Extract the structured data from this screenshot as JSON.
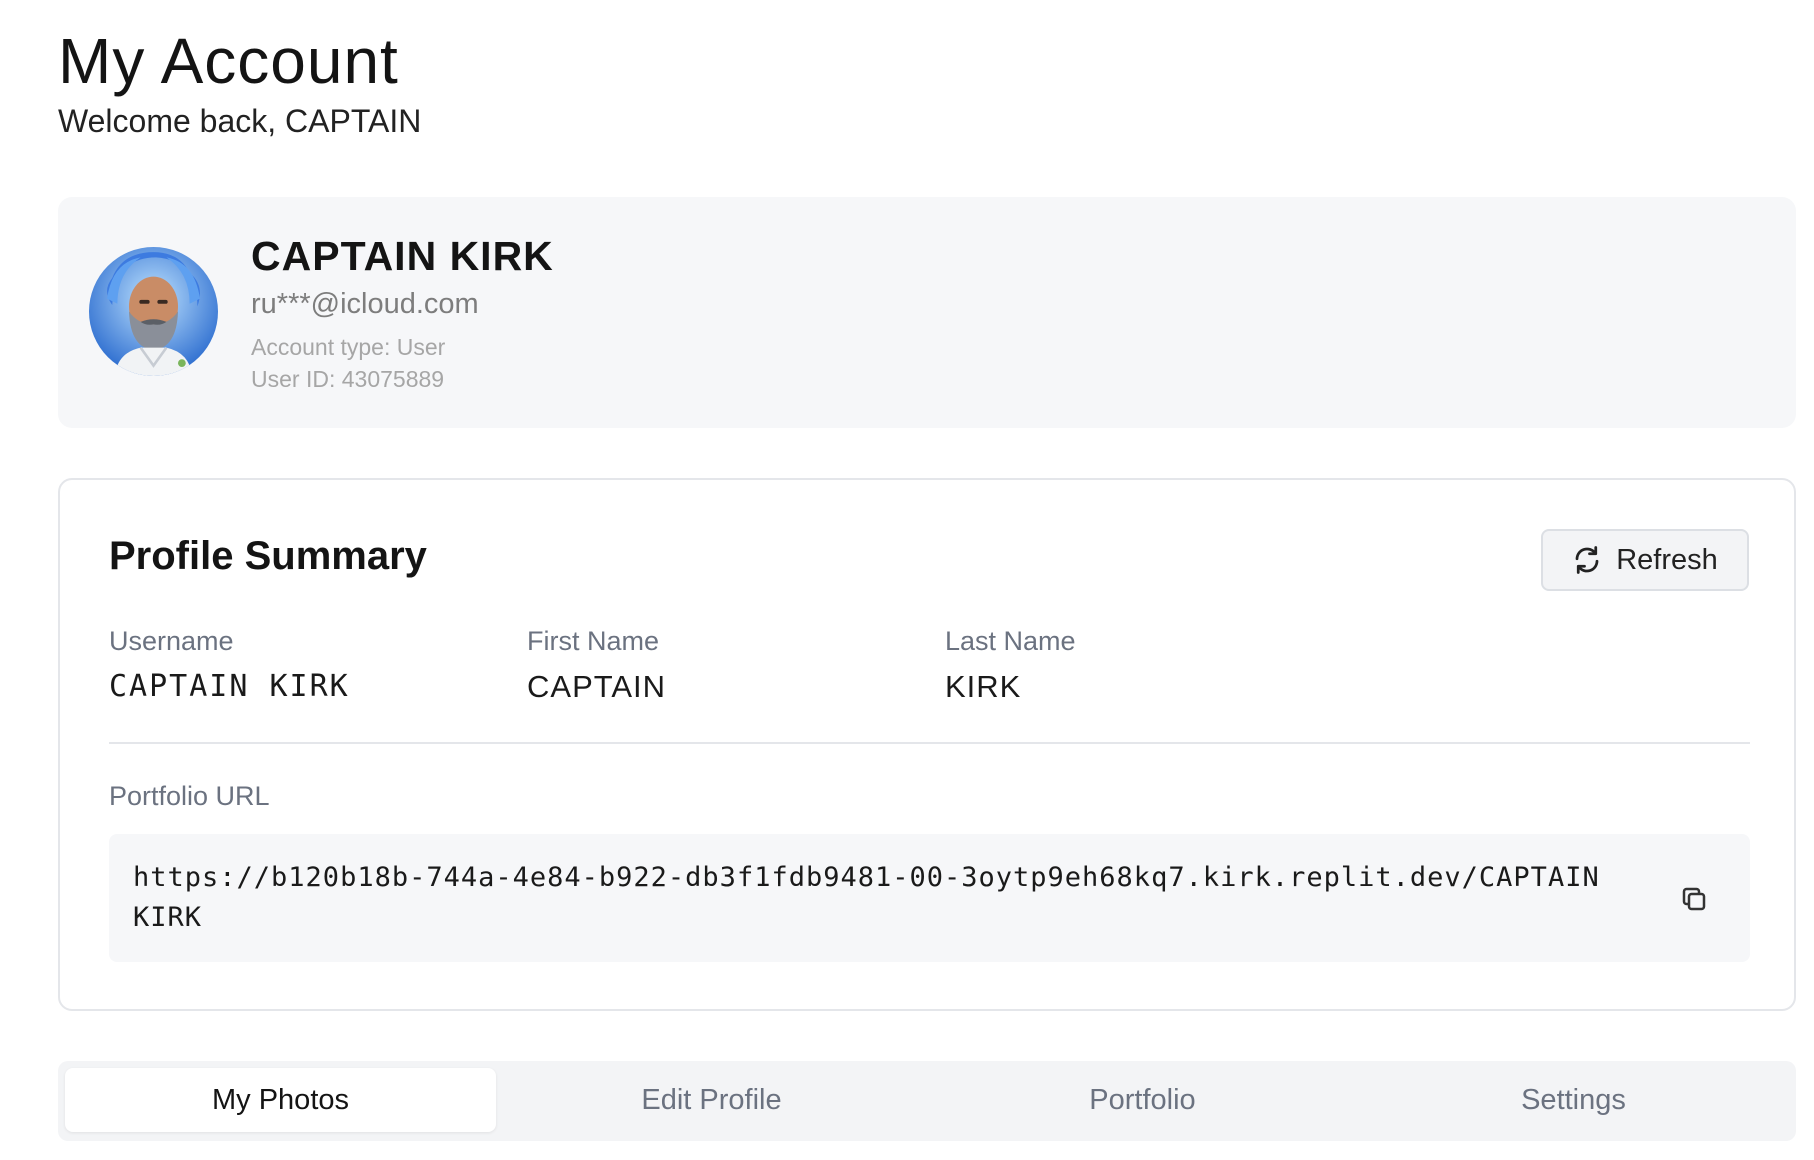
{
  "page": {
    "title": "My Account",
    "subtitle": "Welcome back, CAPTAIN"
  },
  "profile": {
    "name": "CAPTAIN KIRK",
    "email": "ru***@icloud.com",
    "account_type": "Account type: User",
    "user_id": "User ID: 43075889"
  },
  "summary": {
    "title": "Profile Summary",
    "refresh_label": "Refresh",
    "fields": [
      {
        "label": "Username",
        "value": "CAPTAIN KIRK"
      },
      {
        "label": "First Name",
        "value": "CAPTAIN"
      },
      {
        "label": "Last Name",
        "value": "KIRK"
      }
    ],
    "portfolio_label": "Portfolio URL",
    "portfolio_url": "https://b120b18b-744a-4e84-b922-db3f1fdb9481-00-3oytp9eh68kq7.kirk.replit.dev/CAPTAIN KIRK"
  },
  "tabs": [
    {
      "label": "My Photos",
      "active": true
    },
    {
      "label": "Edit Profile",
      "active": false
    },
    {
      "label": "Portfolio",
      "active": false
    },
    {
      "label": "Settings",
      "active": false
    }
  ],
  "icons": {
    "refresh": "refresh-icon",
    "copy": "copy-icon"
  },
  "colors": {
    "card_bg": "#f6f7f9",
    "label": "#6b7280",
    "muted": "#a6a6a6"
  }
}
